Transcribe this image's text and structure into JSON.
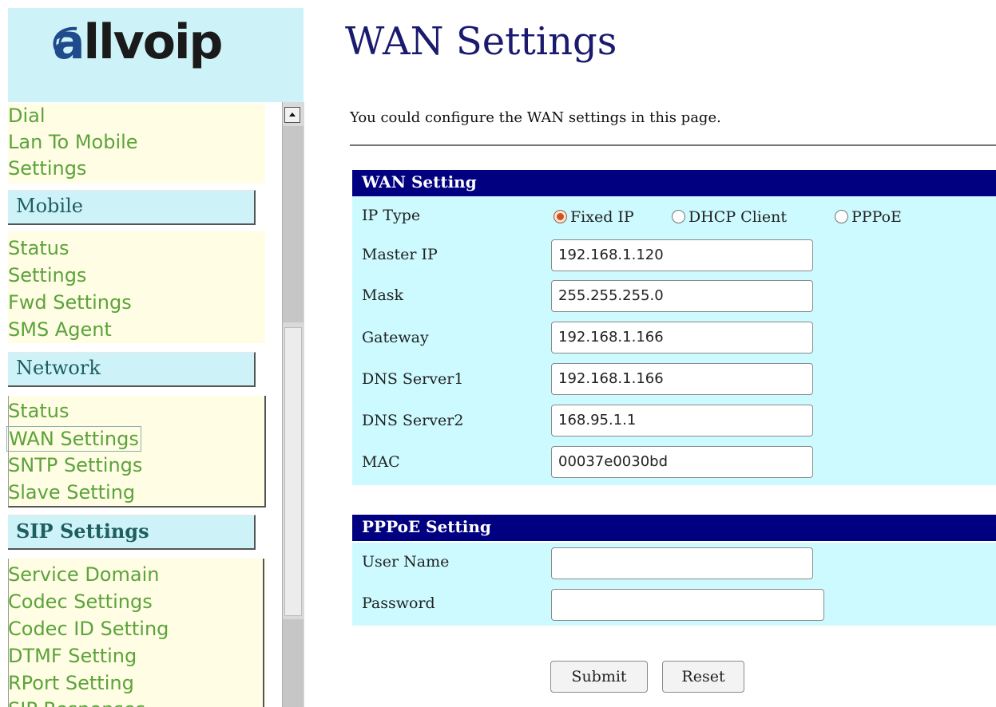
{
  "brand": {
    "logo_text": "allvoip"
  },
  "sidebar": {
    "lan_group": [
      "Dial",
      "Lan To Mobile",
      "Settings"
    ],
    "mobile": {
      "header": "Mobile",
      "items": [
        "Status",
        "Settings",
        "Fwd Settings",
        "SMS Agent"
      ]
    },
    "network": {
      "header": "Network",
      "items": [
        "Status",
        "WAN Settings",
        "SNTP Settings",
        "Slave Setting"
      ],
      "current": "WAN Settings"
    },
    "sip": {
      "header": "SIP Settings",
      "items": [
        "Service Domain",
        "Codec Settings",
        "Codec ID Setting",
        "DTMF Setting",
        "RPort Setting",
        "SIP Responses"
      ]
    }
  },
  "main": {
    "title": "WAN Settings",
    "intro": "You could configure the WAN settings in this page.",
    "wan_section": {
      "title": "WAN Setting",
      "ip_type": {
        "label": "IP Type",
        "options": [
          "Fixed IP",
          "DHCP Client",
          "PPPoE"
        ],
        "selected": "Fixed IP"
      },
      "fields": [
        {
          "label": "Master IP",
          "value": "192.168.1.120"
        },
        {
          "label": "Mask",
          "value": "255.255.255.0"
        },
        {
          "label": "Gateway",
          "value": "192.168.1.166"
        },
        {
          "label": "DNS Server1",
          "value": "192.168.1.166"
        },
        {
          "label": "DNS Server2",
          "value": "168.95.1.1"
        },
        {
          "label": "MAC",
          "value": "00037e0030bd"
        }
      ]
    },
    "pppoe_section": {
      "title": "PPPoE Setting",
      "fields": [
        {
          "label": "User Name",
          "value": ""
        },
        {
          "label": "Password",
          "value": ""
        }
      ]
    },
    "buttons": {
      "submit": "Submit",
      "reset": "Reset"
    }
  },
  "colors": {
    "section_bar": "#000080",
    "row_light": "#ccfaff",
    "sidebar_header": "#cdf2f8",
    "sidebar_group": "#fffde3",
    "nav_link": "#5ba33b",
    "title": "#1a1a6e"
  }
}
